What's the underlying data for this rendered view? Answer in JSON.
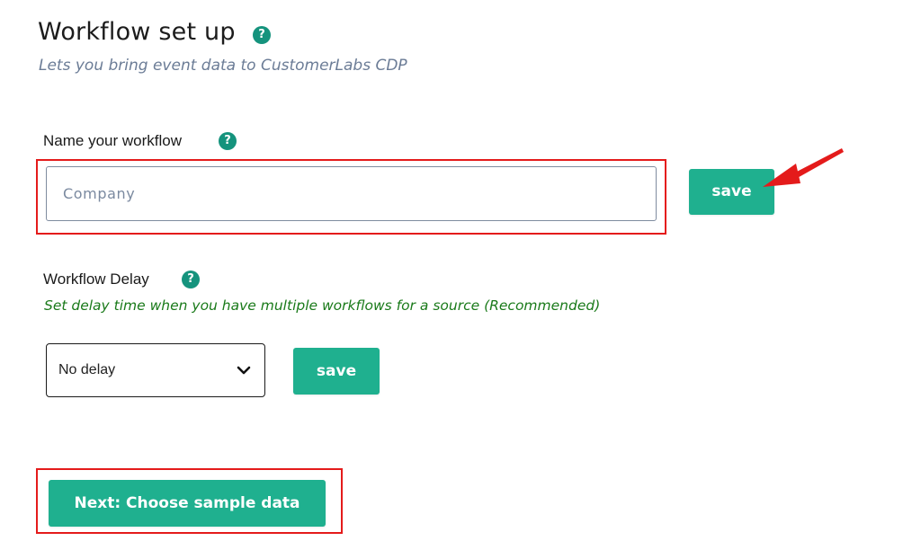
{
  "header": {
    "title": "Workflow set up",
    "subtitle": "Lets you bring event data to CustomerLabs CDP",
    "help_icon": "?"
  },
  "workflow_name": {
    "label": "Name your workflow",
    "help_icon": "?",
    "placeholder": "Company",
    "value": "",
    "save_label": "save"
  },
  "workflow_delay": {
    "label": "Workflow Delay",
    "help_icon": "?",
    "hint": "Set delay time when you have multiple workflows for a source (Recommended)",
    "selected": "No delay",
    "save_label": "save"
  },
  "next_button_label": "Next: Choose sample data",
  "colors": {
    "accent": "#1fb08f",
    "help_icon": "#15937d",
    "highlight": "#e41b1b",
    "hint_text": "#1a7a1a",
    "subtitle_text": "#6b7c96"
  },
  "icons": {
    "help": "question-circle-icon",
    "dropdown": "chevron-down-icon",
    "annotation": "red-arrow-icon"
  }
}
